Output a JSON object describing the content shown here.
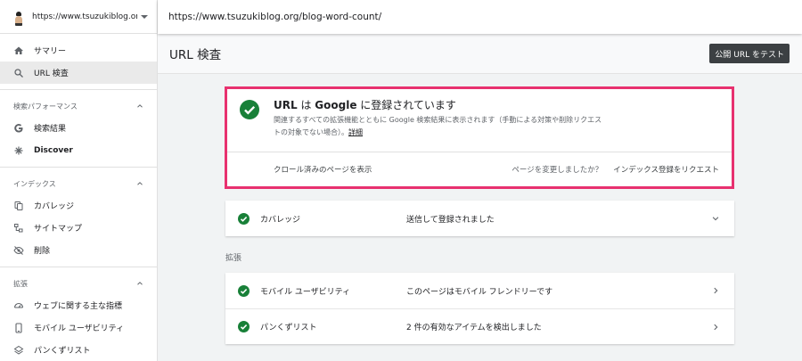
{
  "property": {
    "url": "https://www.tsuzukiblog.org/"
  },
  "url_bar": {
    "inspected_url": "https://www.tsuzukiblog.org/blog-word-count/"
  },
  "sidebar": {
    "top_items": [
      {
        "label": "サマリー",
        "icon": "home-icon"
      },
      {
        "label": "URL 検査",
        "icon": "search-icon",
        "active": true
      }
    ],
    "sections": [
      {
        "title": "検索パフォーマンス",
        "items": [
          {
            "label": "検索結果",
            "icon": "google-g-icon"
          },
          {
            "label": "Discover",
            "icon": "asterisk-icon"
          }
        ]
      },
      {
        "title": "インデックス",
        "items": [
          {
            "label": "カバレッジ",
            "icon": "copy-icon"
          },
          {
            "label": "サイトマップ",
            "icon": "sitemap-icon"
          },
          {
            "label": "削除",
            "icon": "eye-off-icon"
          }
        ]
      },
      {
        "title": "拡張",
        "items": [
          {
            "label": "ウェブに関する主な指標",
            "icon": "gauge-icon"
          },
          {
            "label": "モバイル ユーザビリティ",
            "icon": "phone-icon"
          },
          {
            "label": "パンくずリスト",
            "icon": "layers-icon"
          }
        ]
      }
    ]
  },
  "main": {
    "title": "URL 検査",
    "test_button": "公開 URL をテスト",
    "summary": {
      "title_pre": "URL",
      "title_mid1": " は ",
      "title_brand": "Google",
      "title_post": " に登録されています",
      "description": "関連するすべての拡張機能とともに Google 検索結果に表示されます（手動による対策や削除リクエストの対象でない場合）。",
      "details_link": "詳細",
      "view_crawled": "クロール済みのページを表示",
      "changed_question": "ページを変更しましたか？",
      "request_indexing": "インデックス登録をリクエスト"
    },
    "coverage": {
      "label": "カバレッジ",
      "value": "送信して登録されました"
    },
    "enhancements_label": "拡張",
    "enhancements": [
      {
        "label": "モバイル ユーザビリティ",
        "value": "このページはモバイル フレンドリーです"
      },
      {
        "label": "パンくずリスト",
        "value": "2 件の有効なアイテムを検出しました"
      }
    ]
  },
  "colors": {
    "success": "#188038",
    "highlight": "#e8316f",
    "button_bg": "#3c4043"
  }
}
